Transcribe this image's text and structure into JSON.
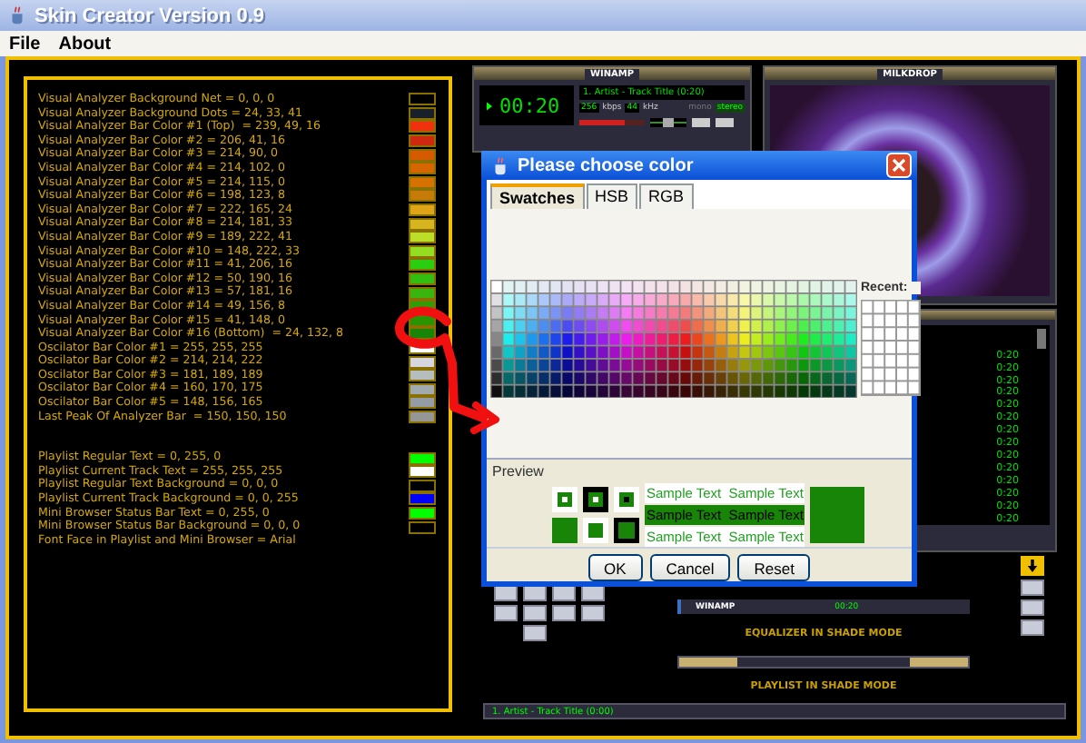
{
  "window": {
    "title": "Skin Creator Version 0.9"
  },
  "menu": [
    "File",
    "About"
  ],
  "settings": {
    "groups": [
      {
        "items": [
          {
            "label": "Visual Analyzer Background Net = 0, 0, 0",
            "color": "#000000"
          },
          {
            "label": "Visual Analyzer Background Dots = 24, 33, 41",
            "color": "#182129"
          },
          {
            "label": "Visual Analyzer Bar Color #1 (Top)  = 239, 49, 16",
            "color": "#ef3110"
          },
          {
            "label": "Visual Analyzer Bar Color #2 = 206, 41, 16",
            "color": "#ce2910"
          },
          {
            "label": "Visual Analyzer Bar Color #3 = 214, 90, 0",
            "color": "#d65a00"
          },
          {
            "label": "Visual Analyzer Bar Color #4 = 214, 102, 0",
            "color": "#d66600"
          },
          {
            "label": "Visual Analyzer Bar Color #5 = 214, 115, 0",
            "color": "#d67300"
          },
          {
            "label": "Visual Analyzer Bar Color #6 = 198, 123, 8",
            "color": "#c67b08"
          },
          {
            "label": "Visual Analyzer Bar Color #7 = 222, 165, 24",
            "color": "#dea518"
          },
          {
            "label": "Visual Analyzer Bar Color #8 = 214, 181, 33",
            "color": "#d6b521"
          },
          {
            "label": "Visual Analyzer Bar Color #9 = 189, 222, 41",
            "color": "#bdde29"
          },
          {
            "label": "Visual Analyzer Bar Color #10 = 148, 222, 33",
            "color": "#94de21"
          },
          {
            "label": "Visual Analyzer Bar Color #11 = 41, 206, 16",
            "color": "#29ce10"
          },
          {
            "label": "Visual Analyzer Bar Color #12 = 50, 190, 16",
            "color": "#32be10"
          },
          {
            "label": "Visual Analyzer Bar Color #13 = 57, 181, 16",
            "color": "#39b510"
          },
          {
            "label": "Visual Analyzer Bar Color #14 = 49, 156, 8",
            "color": "#319c08"
          },
          {
            "label": "Visual Analyzer Bar Color #15 = 41, 148, 0",
            "color": "#299400"
          },
          {
            "label": "Visual Analyzer Bar Color #16 (Bottom)  = 24, 132, 8",
            "color": "#188408"
          },
          {
            "label": "Oscilator Bar Color #1 = 255, 255, 255",
            "color": "#ffffff"
          },
          {
            "label": "Oscilator Bar Color #2 = 214, 214, 222",
            "color": "#d6d6de"
          },
          {
            "label": "Oscilator Bar Color #3 = 181, 189, 189",
            "color": "#b5bdbd"
          },
          {
            "label": "Oscilator Bar Color #4 = 160, 170, 175",
            "color": "#a0aaaf"
          },
          {
            "label": "Oscilator Bar Color #5 = 148, 156, 165",
            "color": "#949ca5"
          },
          {
            "label": "Last Peak Of Analyzer Bar  = 150, 150, 150",
            "color": "#969696"
          }
        ]
      },
      {
        "items": [
          {
            "label": "Playlist Regular Text = 0, 255, 0",
            "color": "#00ff00"
          },
          {
            "label": "Playlist Current Track Text = 255, 255, 255",
            "color": "#ffffff"
          },
          {
            "label": "Playlist Regular Text Background = 0, 0, 0",
            "color": "#000000"
          },
          {
            "label": "Playlist Current Track Background = 0, 0, 255",
            "color": "#0000ff"
          },
          {
            "label": "Mini Browser Status Bar Text = 0, 255, 0",
            "color": "#00ff00"
          },
          {
            "label": "Mini Browser Status Bar Background = 0, 0, 0",
            "color": "#000000"
          },
          {
            "label": "Font Face in Playlist and Mini Browser = Arial"
          }
        ]
      }
    ]
  },
  "skin_preview": {
    "main_window": {
      "title": "WINAMP",
      "time": "00:20",
      "track": "1. Artist - Track Title (0:20)",
      "bitrate": "256",
      "bitrate_unit": "kbps",
      "samplerate": "44",
      "samplerate_unit": "kHz",
      "mono": "mono",
      "stereo": "stereo",
      "volume": {
        "level": 0.7
      },
      "balance": {
        "level": 0.5
      },
      "toggles": [
        {
          "on": false
        },
        {
          "on": false
        }
      ]
    },
    "visualizer": {
      "title": "MILKDROP"
    },
    "playlist": {
      "times": [
        "0:20",
        "0:20",
        "0:20",
        "0:20",
        "0:20",
        "0:20",
        "0:20",
        "0:20",
        "0:20",
        "0:20",
        "0:20",
        "0:20",
        "0:20",
        "0:20"
      ]
    },
    "shade_bar": {
      "title": "WINAMP",
      "time": "00:20"
    },
    "equalizer_caption": "EQUALIZER IN SHADE MODE",
    "playlist_caption": "PLAYLIST IN SHADE MODE",
    "playlist_shade": {
      "track": "1. Artist - Track Title (0:00)"
    }
  },
  "dialog": {
    "title": "Please choose color",
    "tabs": [
      {
        "label": "Swatches",
        "selected": true
      },
      {
        "label": "HSB",
        "selected": false
      },
      {
        "label": "RGB",
        "selected": false
      }
    ],
    "recent_label": "Recent:",
    "preview_label": "Preview",
    "sample_texts": [
      {
        "kind": "plain",
        "text": "Sample Text  Sample Text"
      },
      {
        "kind": "filled",
        "text": "Sample Text  Sample Text"
      },
      {
        "kind": "plain",
        "text": "Sample Text  Sample Text"
      }
    ],
    "buttons": [
      "OK",
      "Cancel",
      "Reset"
    ]
  }
}
